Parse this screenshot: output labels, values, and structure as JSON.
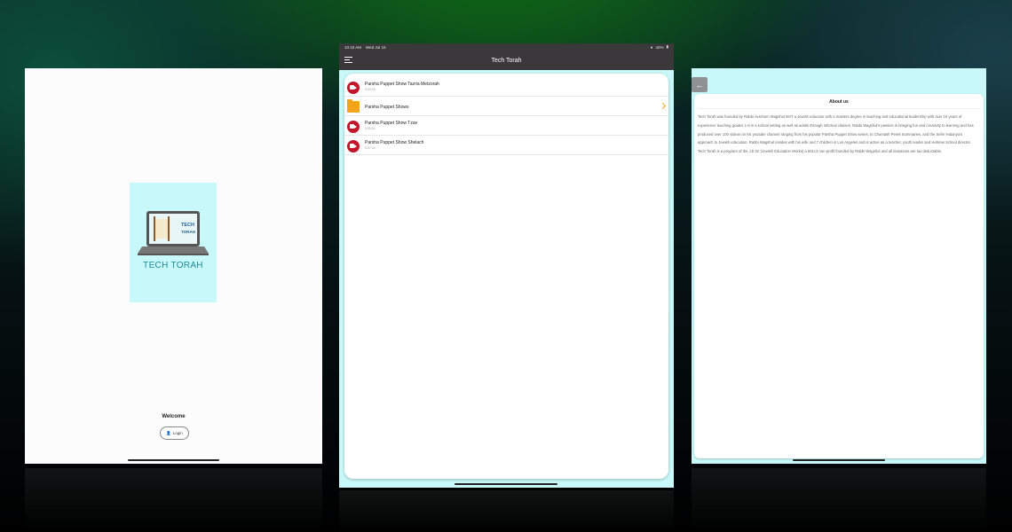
{
  "welcome_screen": {
    "logo_text": "TECH TORAH",
    "logo_badge": "TECH\nTORAH",
    "welcome_label": "Welcome",
    "login_label": "Login"
  },
  "list_screen": {
    "status_time": "10:19 AM",
    "status_date": "Wed Jul 15",
    "status_battery": "42%",
    "title": "Tech Torah",
    "items": [
      {
        "title": "Parsha Puppet Show Tazria Metzorah",
        "subtitle": "0:03:28",
        "icon": "video-icon"
      },
      {
        "title": "Parsha Puppet Shows",
        "subtitle": "",
        "icon": "folder-icon"
      },
      {
        "title": "Parsha Puppet Show Tzav",
        "subtitle": "0:03:31",
        "icon": "video-icon"
      },
      {
        "title": "Parsha Puppet Show Shelach",
        "subtitle": "0:07:34",
        "icon": "video-icon"
      }
    ]
  },
  "about_screen": {
    "title": "About us",
    "body": "Tech Torah was founded by Rabbi Avrohom Wagshul MAT a Jewish educator with a masters degree in teaching and educational leadership with over 10 years of experience teaching grades 1-8 in a school setting as well as adults through informal classes. Rabbi Wagshul's passion is bringing fun and creativity to learning and has produced over 100 videos on his youtube channel ranging from his popular Parsha Puppet Show series, to Chumash Perek Summaries, and the Sefer Hatanya's approach to Jewish education. Rabbi Wagshul resides with his wife and 7 children in Los Angeles and is active as a teacher, youth leader and Hebrew School director. Tech Torah is a program of the J.E.W. (Jewish Education Works) a 501c3 non-profit founded by Rabbi Wagshul and all donations are tax deductable."
  },
  "colors": {
    "accent_cyan": "#c8f8f9",
    "navbar": "#3a383a",
    "video_red": "#c2172b",
    "folder_orange": "#f2a41d"
  }
}
